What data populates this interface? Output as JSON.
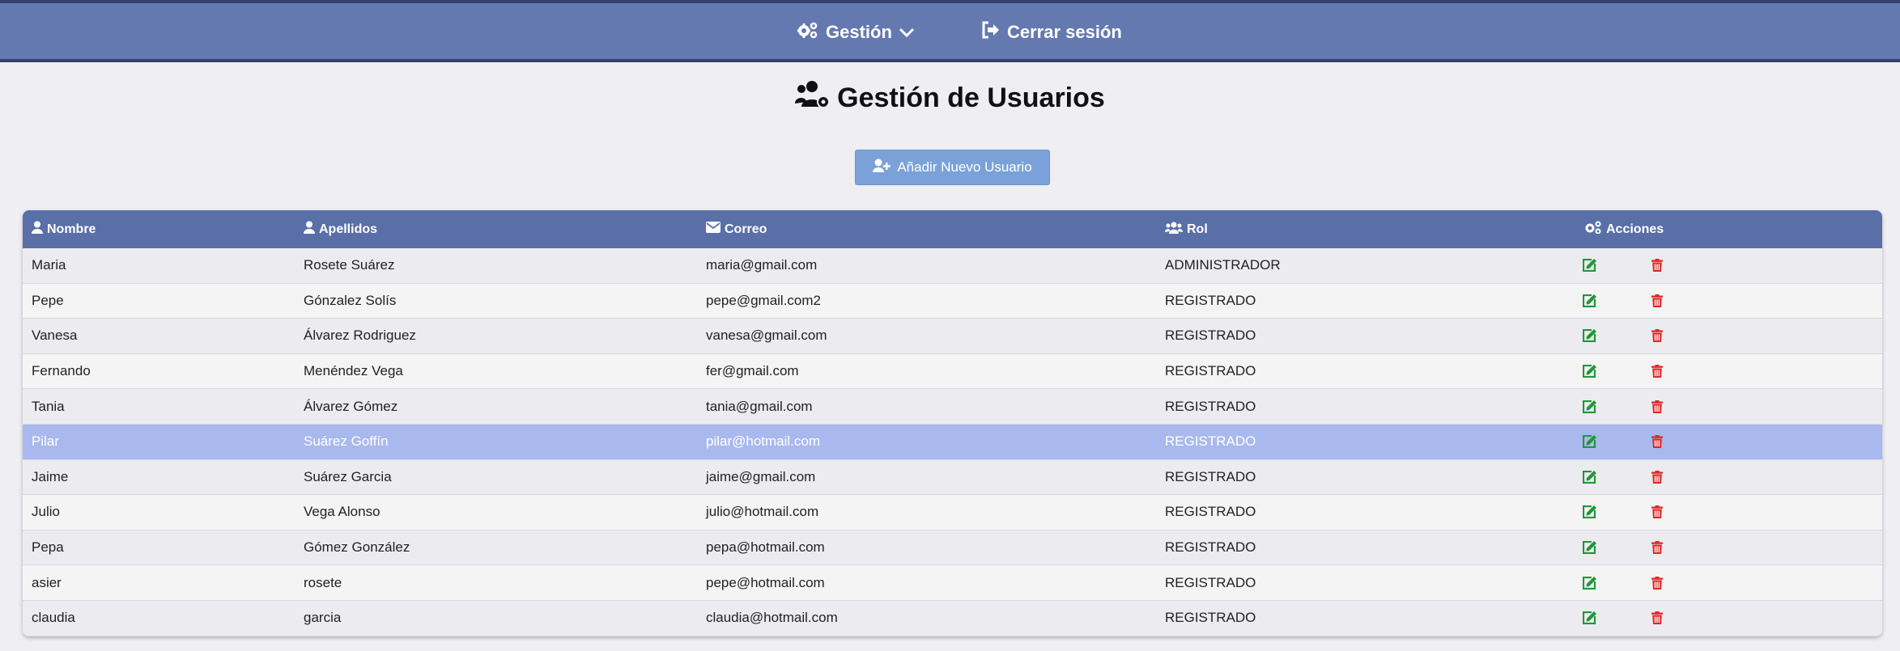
{
  "nav": {
    "gestion_label": "Gestión",
    "logout_label": "Cerrar sesión"
  },
  "page": {
    "title": "Gestión de Usuarios",
    "add_button_label": "Añadir Nuevo Usuario"
  },
  "table": {
    "headers": [
      "Nombre",
      "Apellidos",
      "Correo",
      "Rol",
      "Acciones"
    ],
    "rows": [
      {
        "nombre": "Maria",
        "apellidos": "Rosete Suárez",
        "correo": "maria@gmail.com",
        "rol": "ADMINISTRADOR"
      },
      {
        "nombre": "Pepe",
        "apellidos": "Gónzalez Solís",
        "correo": "pepe@gmail.com2",
        "rol": "REGISTRADO"
      },
      {
        "nombre": "Vanesa",
        "apellidos": "Álvarez Rodriguez",
        "correo": "vanesa@gmail.com",
        "rol": "REGISTRADO"
      },
      {
        "nombre": "Fernando",
        "apellidos": "Menéndez Vega",
        "correo": "fer@gmail.com",
        "rol": "REGISTRADO"
      },
      {
        "nombre": "Tania",
        "apellidos": "Álvarez Gómez",
        "correo": "tania@gmail.com",
        "rol": "REGISTRADO"
      },
      {
        "nombre": "Pilar",
        "apellidos": "Suárez Goffín",
        "correo": "pilar@hotmail.com",
        "rol": "REGISTRADO"
      },
      {
        "nombre": "Jaime",
        "apellidos": "Suárez Garcia",
        "correo": "jaime@gmail.com",
        "rol": "REGISTRADO"
      },
      {
        "nombre": "Julio",
        "apellidos": "Vega Alonso",
        "correo": "julio@hotmail.com",
        "rol": "REGISTRADO"
      },
      {
        "nombre": "Pepa",
        "apellidos": "Gómez González",
        "correo": "pepa@hotmail.com",
        "rol": "REGISTRADO"
      },
      {
        "nombre": "asier",
        "apellidos": "rosete",
        "correo": "pepe@hotmail.com",
        "rol": "REGISTRADO"
      },
      {
        "nombre": "claudia",
        "apellidos": "garcia",
        "correo": "claudia@hotmail.com",
        "rol": "REGISTRADO"
      }
    ],
    "selected_row": 5
  },
  "colors": {
    "navbar": "#6479b0",
    "table_header": "#5a6fa8",
    "add_button": "#7aa2d8",
    "selected_row": "#a9b9ee",
    "edit_icon": "#22963a",
    "delete_icon": "#e02828"
  },
  "icons": {
    "gestion": "gears-icon",
    "dropdown": "chevron-down-icon",
    "logout": "sign-out-icon",
    "title": "users-cog-icon",
    "add": "user-plus-icon",
    "edit": "edit-icon",
    "delete": "trash-icon"
  }
}
